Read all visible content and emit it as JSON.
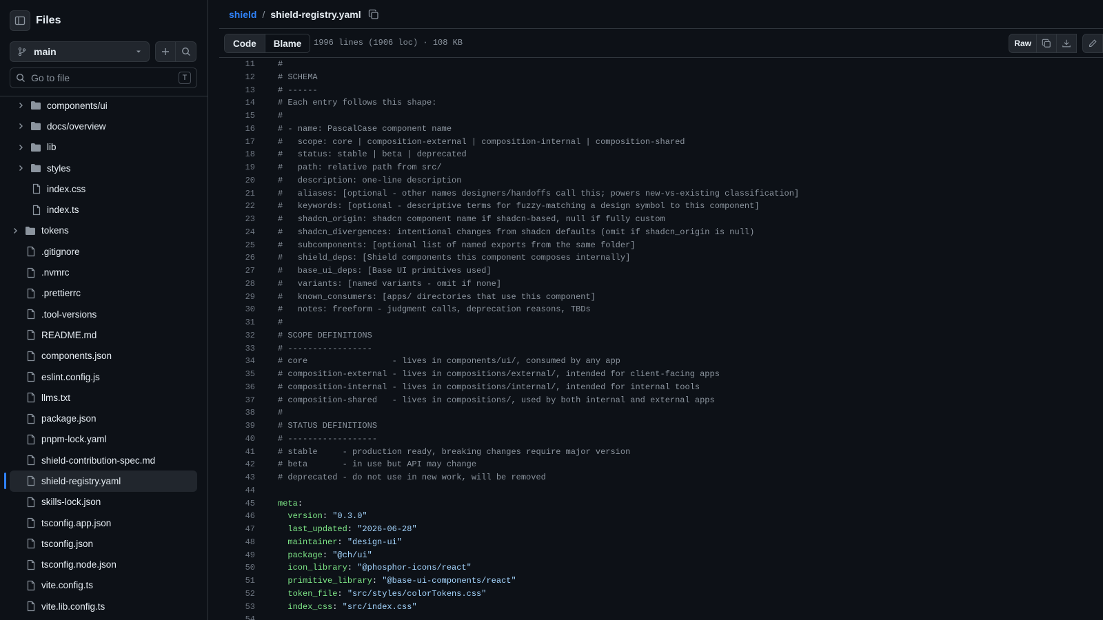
{
  "sidebar": {
    "title": "Files",
    "branch": "main",
    "search_placeholder": "Go to file",
    "search_shortcut": "T",
    "tree": [
      {
        "label": "components/ui",
        "type": "folder",
        "depth": 1,
        "chevron": true
      },
      {
        "label": "docs/overview",
        "type": "folder",
        "depth": 1,
        "chevron": true
      },
      {
        "label": "lib",
        "type": "folder",
        "depth": 1,
        "chevron": true
      },
      {
        "label": "styles",
        "type": "folder",
        "depth": 1,
        "chevron": true
      },
      {
        "label": "index.css",
        "type": "file",
        "depth": 1
      },
      {
        "label": "index.ts",
        "type": "file",
        "depth": 1
      },
      {
        "label": "tokens",
        "type": "folder",
        "depth": 0,
        "chevron": true
      },
      {
        "label": ".gitignore",
        "type": "file",
        "depth": 0
      },
      {
        "label": ".nvmrc",
        "type": "file",
        "depth": 0
      },
      {
        "label": ".prettierrc",
        "type": "file",
        "depth": 0
      },
      {
        "label": ".tool-versions",
        "type": "file",
        "depth": 0
      },
      {
        "label": "README.md",
        "type": "file",
        "depth": 0
      },
      {
        "label": "components.json",
        "type": "file",
        "depth": 0
      },
      {
        "label": "eslint.config.js",
        "type": "file",
        "depth": 0
      },
      {
        "label": "llms.txt",
        "type": "file",
        "depth": 0
      },
      {
        "label": "package.json",
        "type": "file",
        "depth": 0
      },
      {
        "label": "pnpm-lock.yaml",
        "type": "file",
        "depth": 0
      },
      {
        "label": "shield-contribution-spec.md",
        "type": "file",
        "depth": 0
      },
      {
        "label": "shield-registry.yaml",
        "type": "file",
        "depth": 0,
        "active": true
      },
      {
        "label": "skills-lock.json",
        "type": "file",
        "depth": 0
      },
      {
        "label": "tsconfig.app.json",
        "type": "file",
        "depth": 0
      },
      {
        "label": "tsconfig.json",
        "type": "file",
        "depth": 0
      },
      {
        "label": "tsconfig.node.json",
        "type": "file",
        "depth": 0
      },
      {
        "label": "vite.config.ts",
        "type": "file",
        "depth": 0
      },
      {
        "label": "vite.lib.config.ts",
        "type": "file",
        "depth": 0
      }
    ]
  },
  "breadcrumb": {
    "repo": "shield",
    "separator": "/",
    "file": "shield-registry.yaml"
  },
  "toolbar": {
    "code_tab": "Code",
    "blame_tab": "Blame",
    "file_info": "1996 lines (1906 loc) · 108 KB",
    "raw_label": "Raw"
  },
  "code": [
    {
      "n": "11",
      "parts": [
        [
          "c",
          "#"
        ]
      ]
    },
    {
      "n": "12",
      "parts": [
        [
          "c",
          "# SCHEMA"
        ]
      ]
    },
    {
      "n": "13",
      "parts": [
        [
          "c",
          "# ------"
        ]
      ]
    },
    {
      "n": "14",
      "parts": [
        [
          "c",
          "# Each entry follows this shape:"
        ]
      ]
    },
    {
      "n": "15",
      "parts": [
        [
          "c",
          "#"
        ]
      ]
    },
    {
      "n": "16",
      "parts": [
        [
          "c",
          "# - name: PascalCase component name"
        ]
      ]
    },
    {
      "n": "17",
      "parts": [
        [
          "c",
          "#   scope: core | composition-external | composition-internal | composition-shared"
        ]
      ]
    },
    {
      "n": "18",
      "parts": [
        [
          "c",
          "#   status: stable | beta | deprecated"
        ]
      ]
    },
    {
      "n": "19",
      "parts": [
        [
          "c",
          "#   path: relative path from src/"
        ]
      ]
    },
    {
      "n": "20",
      "parts": [
        [
          "c",
          "#   description: one-line description"
        ]
      ]
    },
    {
      "n": "21",
      "parts": [
        [
          "c",
          "#   aliases: [optional - other names designers/handoffs call this; powers new-vs-existing classification]"
        ]
      ]
    },
    {
      "n": "22",
      "parts": [
        [
          "c",
          "#   keywords: [optional - descriptive terms for fuzzy-matching a design symbol to this component]"
        ]
      ]
    },
    {
      "n": "23",
      "parts": [
        [
          "c",
          "#   shadcn_origin: shadcn component name if shadcn-based, null if fully custom"
        ]
      ]
    },
    {
      "n": "24",
      "parts": [
        [
          "c",
          "#   shadcn_divergences: intentional changes from shadcn defaults (omit if shadcn_origin is null)"
        ]
      ]
    },
    {
      "n": "25",
      "parts": [
        [
          "c",
          "#   subcomponents: [optional list of named exports from the same folder]"
        ]
      ]
    },
    {
      "n": "26",
      "parts": [
        [
          "c",
          "#   shield_deps: [Shield components this component composes internally]"
        ]
      ]
    },
    {
      "n": "27",
      "parts": [
        [
          "c",
          "#   base_ui_deps: [Base UI primitives used]"
        ]
      ]
    },
    {
      "n": "28",
      "parts": [
        [
          "c",
          "#   variants: [named variants - omit if none]"
        ]
      ]
    },
    {
      "n": "29",
      "parts": [
        [
          "c",
          "#   known_consumers: [apps/ directories that use this component]"
        ]
      ]
    },
    {
      "n": "30",
      "parts": [
        [
          "c",
          "#   notes: freeform - judgment calls, deprecation reasons, TBDs"
        ]
      ]
    },
    {
      "n": "31",
      "parts": [
        [
          "c",
          "#"
        ]
      ]
    },
    {
      "n": "32",
      "parts": [
        [
          "c",
          "# SCOPE DEFINITIONS"
        ]
      ]
    },
    {
      "n": "33",
      "parts": [
        [
          "c",
          "# -----------------"
        ]
      ]
    },
    {
      "n": "34",
      "parts": [
        [
          "c",
          "# core                 - lives in components/ui/, consumed by any app"
        ]
      ]
    },
    {
      "n": "35",
      "parts": [
        [
          "c",
          "# composition-external - lives in compositions/external/, intended for client-facing apps"
        ]
      ]
    },
    {
      "n": "36",
      "parts": [
        [
          "c",
          "# composition-internal - lives in compositions/internal/, intended for internal tools"
        ]
      ]
    },
    {
      "n": "37",
      "parts": [
        [
          "c",
          "# composition-shared   - lives in compositions/, used by both internal and external apps"
        ]
      ]
    },
    {
      "n": "38",
      "parts": [
        [
          "c",
          "#"
        ]
      ]
    },
    {
      "n": "39",
      "parts": [
        [
          "c",
          "# STATUS DEFINITIONS"
        ]
      ]
    },
    {
      "n": "40",
      "parts": [
        [
          "c",
          "# ------------------"
        ]
      ]
    },
    {
      "n": "41",
      "parts": [
        [
          "c",
          "# stable     - production ready, breaking changes require major version"
        ]
      ]
    },
    {
      "n": "42",
      "parts": [
        [
          "c",
          "# beta       - in use but API may change"
        ]
      ]
    },
    {
      "n": "43",
      "parts": [
        [
          "c",
          "# deprecated - do not use in new work, will be removed"
        ]
      ]
    },
    {
      "n": "44",
      "parts": []
    },
    {
      "n": "45",
      "parts": [
        [
          "k",
          "meta"
        ],
        [
          "p",
          ":"
        ]
      ]
    },
    {
      "n": "46",
      "parts": [
        [
          "p",
          "  "
        ],
        [
          "k",
          "version"
        ],
        [
          "p",
          ": "
        ],
        [
          "s",
          "\"0.3.0\""
        ]
      ]
    },
    {
      "n": "47",
      "parts": [
        [
          "p",
          "  "
        ],
        [
          "k",
          "last_updated"
        ],
        [
          "p",
          ": "
        ],
        [
          "s",
          "\"2026-06-28\""
        ]
      ]
    },
    {
      "n": "48",
      "parts": [
        [
          "p",
          "  "
        ],
        [
          "k",
          "maintainer"
        ],
        [
          "p",
          ": "
        ],
        [
          "s",
          "\"design-ui\""
        ]
      ]
    },
    {
      "n": "49",
      "parts": [
        [
          "p",
          "  "
        ],
        [
          "k",
          "package"
        ],
        [
          "p",
          ": "
        ],
        [
          "s",
          "\"@ch/ui\""
        ]
      ]
    },
    {
      "n": "50",
      "parts": [
        [
          "p",
          "  "
        ],
        [
          "k",
          "icon_library"
        ],
        [
          "p",
          ": "
        ],
        [
          "s",
          "\"@phosphor-icons/react\""
        ]
      ]
    },
    {
      "n": "51",
      "parts": [
        [
          "p",
          "  "
        ],
        [
          "k",
          "primitive_library"
        ],
        [
          "p",
          ": "
        ],
        [
          "s",
          "\"@base-ui-components/react\""
        ]
      ]
    },
    {
      "n": "52",
      "parts": [
        [
          "p",
          "  "
        ],
        [
          "k",
          "token_file"
        ],
        [
          "p",
          ": "
        ],
        [
          "s",
          "\"src/styles/colorTokens.css\""
        ]
      ]
    },
    {
      "n": "53",
      "parts": [
        [
          "p",
          "  "
        ],
        [
          "k",
          "index_css"
        ],
        [
          "p",
          ": "
        ],
        [
          "s",
          "\"src/index.css\""
        ]
      ]
    },
    {
      "n": "54",
      "parts": []
    }
  ]
}
